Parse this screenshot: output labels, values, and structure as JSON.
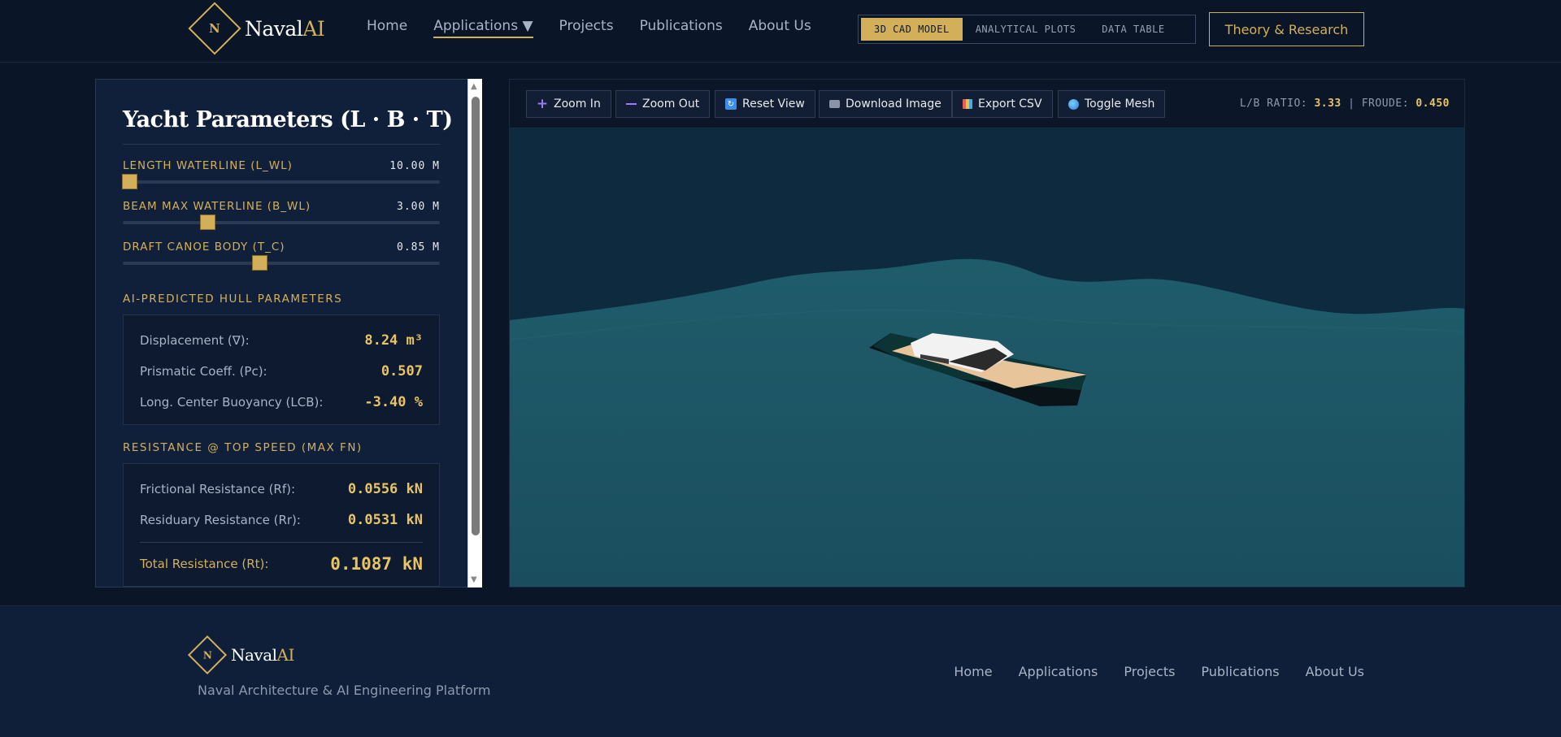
{
  "brand": {
    "initial": "N",
    "name_main": "Naval",
    "name_accent": "AI"
  },
  "nav": {
    "home": "Home",
    "applications": "Applications ▼",
    "projects": "Projects",
    "publications": "Publications",
    "about": "About Us"
  },
  "view_tabs": {
    "cad": "3D CAD MODEL",
    "plots": "ANALYTICAL PLOTS",
    "table": "DATA TABLE",
    "active": "3D CAD MODEL"
  },
  "theory_button": "Theory & Research",
  "panel": {
    "title": "Yacht Parameters (L · B · T)",
    "sliders": [
      {
        "label": "LENGTH WATERLINE (L_WL)",
        "value": "10.00 M",
        "fraction": 0.0
      },
      {
        "label": "BEAM MAX WATERLINE (B_WL)",
        "value": "3.00 M",
        "fraction": 0.26
      },
      {
        "label": "DRAFT CANOE BODY (T_C)",
        "value": "0.85 M",
        "fraction": 0.43
      }
    ],
    "hull_section_title": "AI-PREDICTED HULL PARAMETERS",
    "hull_metrics": [
      {
        "label": "Displacement (∇):",
        "value": "8.24 m³"
      },
      {
        "label": "Prismatic Coeff. (Pc):",
        "value": "0.507"
      },
      {
        "label": "Long. Center Buoyancy (LCB):",
        "value": "-3.40 %"
      }
    ],
    "resistance_section_title": "RESISTANCE @ TOP SPEED (MAX FN)",
    "resistance_metrics": [
      {
        "label": "Frictional Resistance (Rf):",
        "value": "0.0556 kN"
      },
      {
        "label": "Residuary Resistance (Rr):",
        "value": "0.0531 kN"
      }
    ],
    "total": {
      "label": "Total Resistance (Rt):",
      "value": "0.1087 kN"
    }
  },
  "toolbar": {
    "zoom_in": "Zoom In",
    "zoom_out": "Zoom Out",
    "reset": "Reset View",
    "download": "Download Image",
    "export": "Export CSV",
    "mesh": "Toggle Mesh",
    "icons": [
      "plus-icon",
      "minus-icon",
      "reset-icon",
      "camera-icon",
      "chart-icon",
      "globe-icon"
    ]
  },
  "readout": {
    "lb_label": "L/B RATIO:",
    "lb_value": "3.33",
    "sep": "|",
    "froude_label": "FROUDE:",
    "froude_value": "0.450"
  },
  "footer": {
    "tagline": "Naval Architecture & AI Engineering Platform",
    "nav": [
      "Home",
      "Applications",
      "Projects",
      "Publications",
      "About Us"
    ]
  },
  "colors": {
    "background": "#0a1628",
    "panel": "#11203a",
    "accent_gold": "#d4af5a",
    "value_gold": "#e8c466",
    "sea": "#1f5c6b",
    "sky": "#0d2a3e"
  }
}
